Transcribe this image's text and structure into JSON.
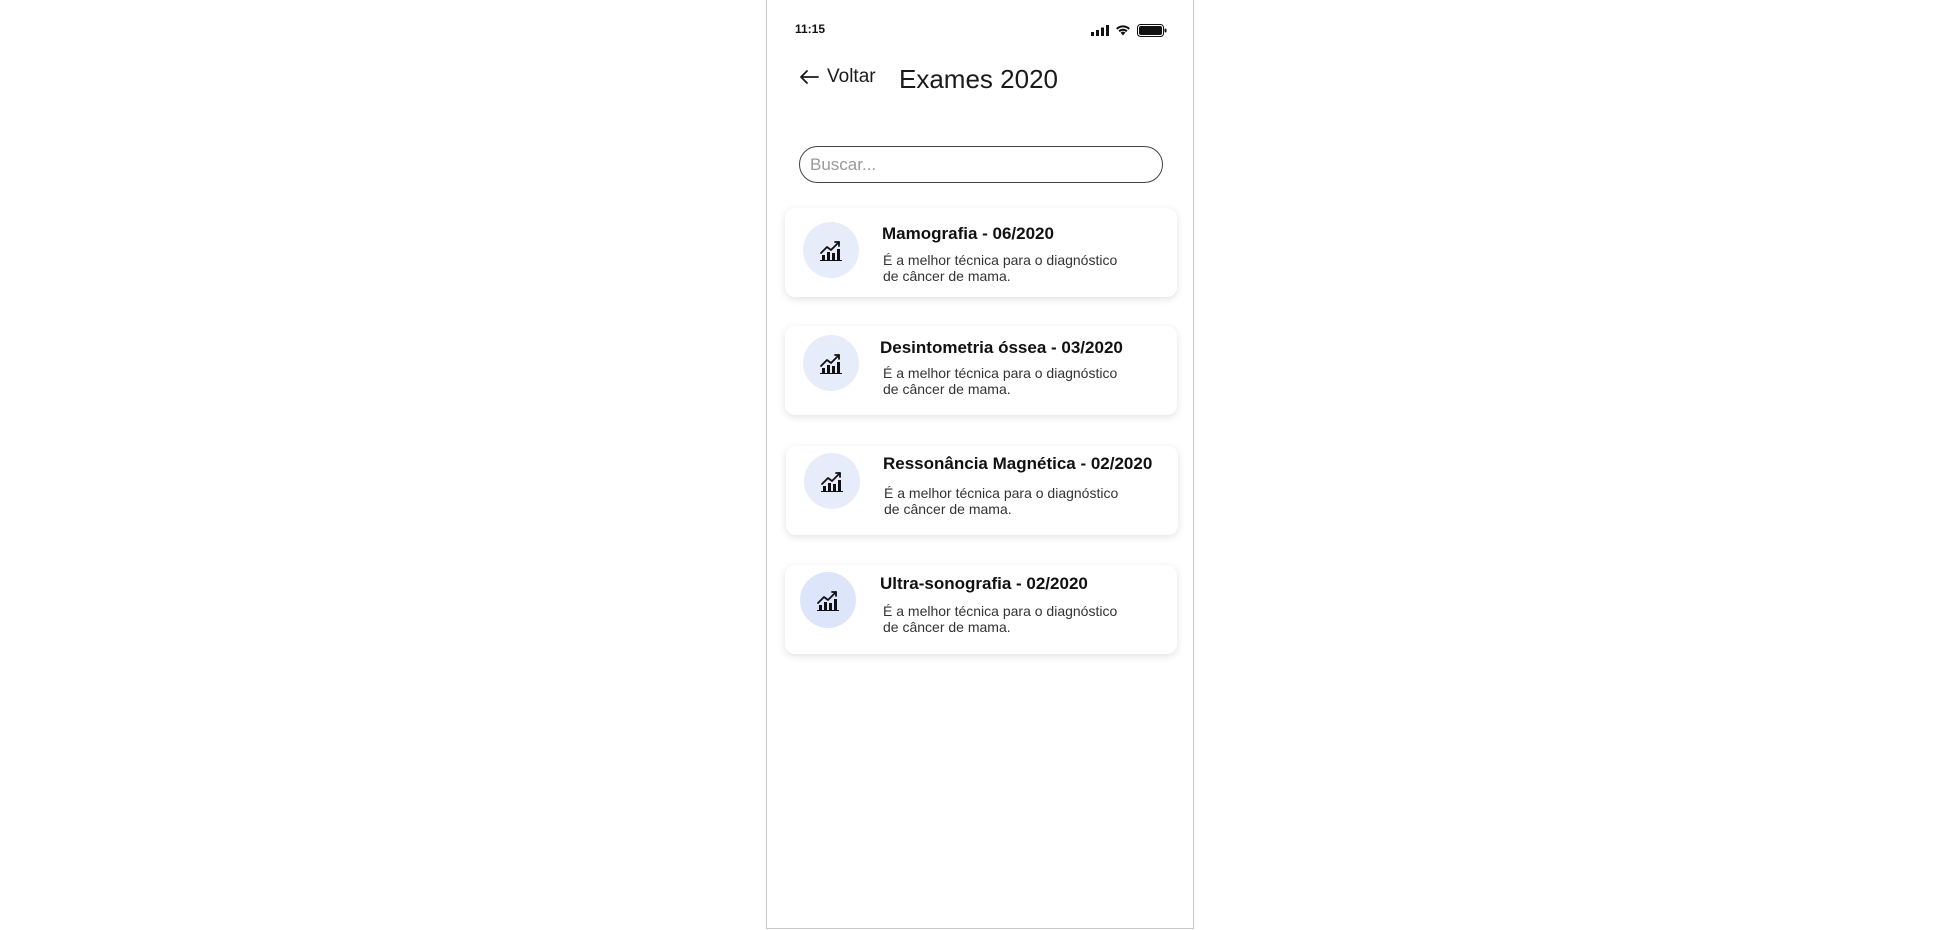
{
  "status_bar": {
    "time": "11:15"
  },
  "header": {
    "back_label": "Voltar",
    "title": "Exames 2020"
  },
  "search": {
    "placeholder": "Buscar..."
  },
  "exams": [
    {
      "title": "Mamografia - 06/2020",
      "description": "É a melhor técnica para o diagnóstico de câncer de mama.",
      "icon": "chart-growth-icon"
    },
    {
      "title": "Desintometria óssea - 03/2020",
      "description": "É a melhor técnica para o diagnóstico de câncer de mama.",
      "icon": "chart-growth-icon"
    },
    {
      "title": "Ressonância Magnética - 02/2020",
      "description": "É a melhor técnica para o diagnóstico de câncer de mama.",
      "icon": "chart-growth-icon"
    },
    {
      "title": "Ultra-sonografia - 02/2020",
      "description": "É a melhor técnica para o diagnóstico de câncer de mama.",
      "icon": "chart-growth-icon"
    }
  ],
  "colors": {
    "icon_bg": "#e6ecfa",
    "card_bg": "#ffffff",
    "text": "#111111"
  }
}
